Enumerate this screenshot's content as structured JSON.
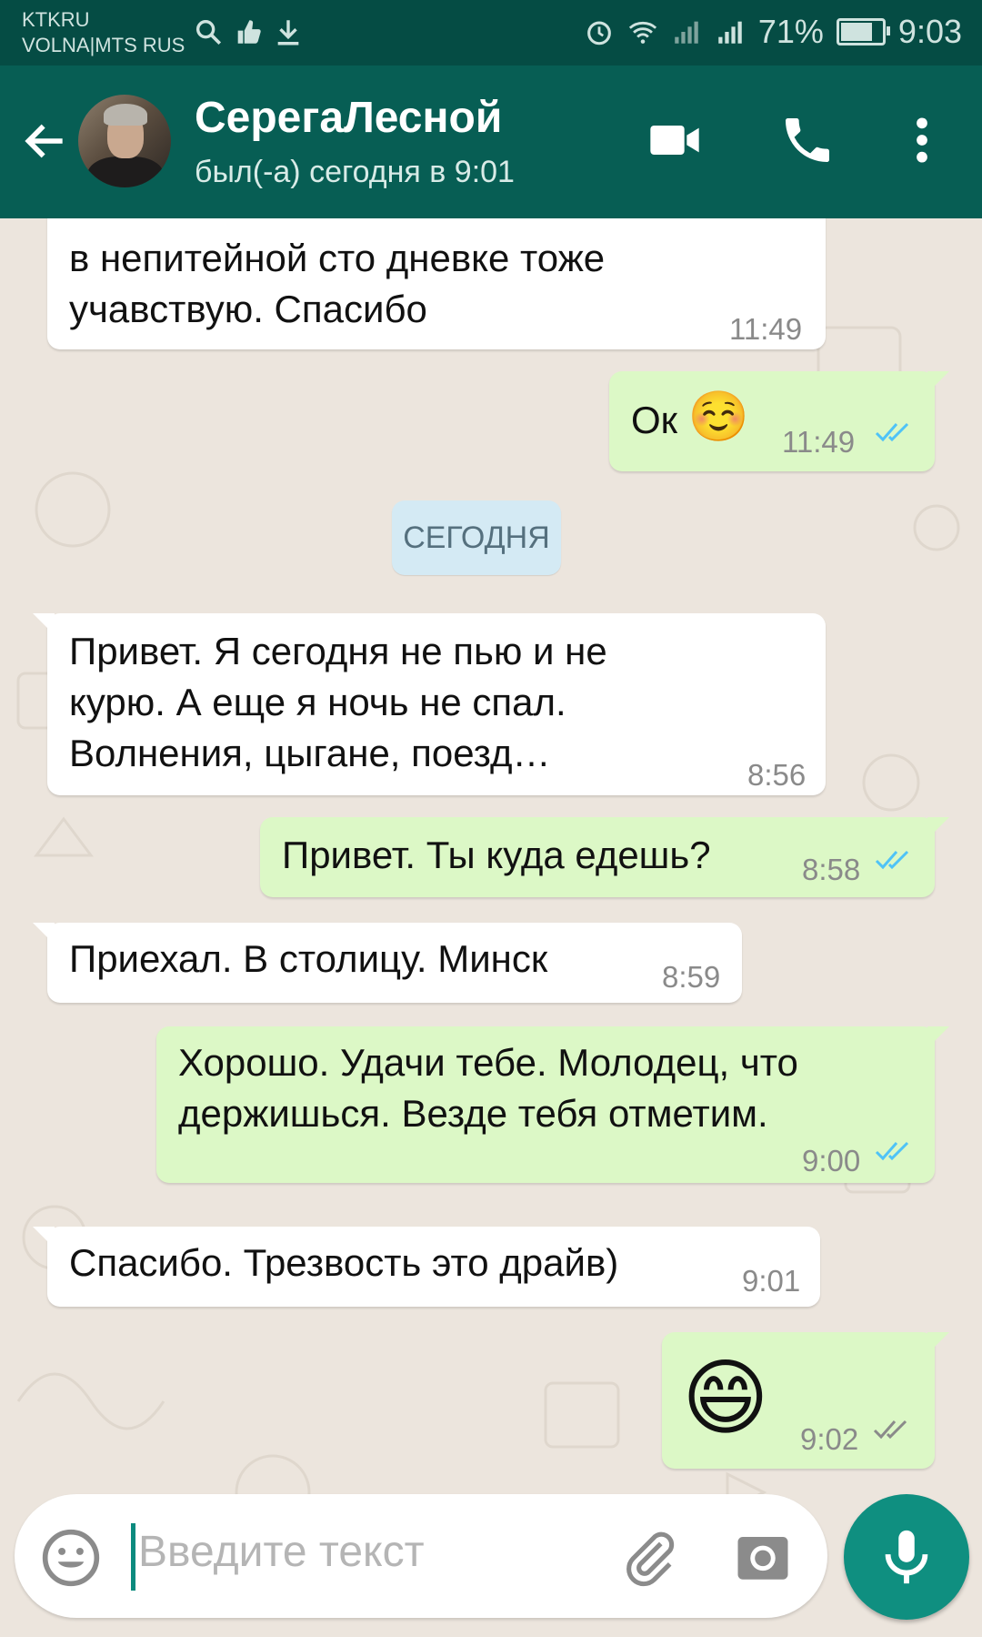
{
  "status_bar": {
    "carrier_line1": "KTKRU",
    "carrier_line2": "VOLNA|MTS RUS",
    "battery": "71%",
    "battery_level": 0.71,
    "time": "9:03"
  },
  "header": {
    "contact_name": "СерегаЛесной",
    "last_seen": "был(-а) сегодня в 9:01"
  },
  "messages": [
    {
      "direction": "in",
      "text": "в непитейной сто дневке тоже учавствую. Спасибо",
      "time": "11:49"
    },
    {
      "direction": "out",
      "text": "Ок",
      "emoji": "☺️",
      "time": "11:49",
      "status": "read"
    },
    {
      "direction": "in",
      "text": "Привет. Я сегодня не пью и не курю. А еще я ночь не спал. Волнения, цыгане, поезд…",
      "time": "8:56"
    },
    {
      "direction": "out",
      "text": "Привет. Ты куда едешь?",
      "time": "8:58",
      "status": "read"
    },
    {
      "direction": "in",
      "text": "Приехал. В столицу. Минск",
      "time": "8:59"
    },
    {
      "direction": "out",
      "text": "Хорошо. Удачи тебе. Молодец, что держишься. Везде тебя отметим.",
      "time": "9:00",
      "status": "read"
    },
    {
      "direction": "in",
      "text": "Спасибо. Трезвость это драйв)",
      "time": "9:01"
    },
    {
      "direction": "out",
      "emoji": "😄",
      "time": "9:02",
      "status": "delivered"
    }
  ],
  "date_separator": "СЕГОДНЯ",
  "composer": {
    "placeholder": "Введите текст"
  },
  "colors": {
    "header": "#075e54",
    "status_bar": "#054c44",
    "outgoing_bubble": "#dcf8c6",
    "incoming_bubble": "#ffffff",
    "read_ticks": "#4fc3f7",
    "mic_button": "#0f8f80"
  },
  "icons": [
    "back-arrow-icon",
    "video-call-icon",
    "phone-icon",
    "more-icon",
    "emoji-icon",
    "attach-icon",
    "camera-icon",
    "mic-icon"
  ]
}
